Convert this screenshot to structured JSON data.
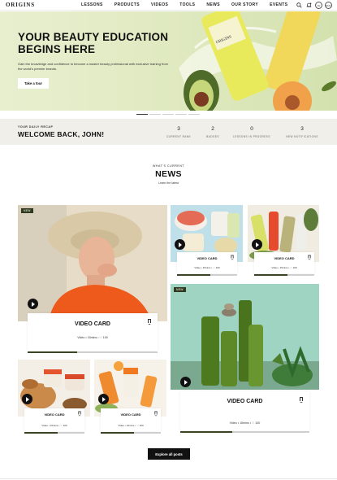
{
  "nav": {
    "logo": "ORIGINS",
    "menu": [
      "LESSONS",
      "PRODUCTS",
      "VIDEOS",
      "TOOLS",
      "NEWS",
      "OUR STORY",
      "EVENTS"
    ],
    "avatar_initials": "JH",
    "language": "ENG"
  },
  "hero": {
    "title": "YOUR BEAUTY EDUCATION BEGINS HERE",
    "subtitle": "Gain the knowledge and confidence to become a master beauty professional with exclusive training from the world's premier brands.",
    "cta": "Take a tour",
    "background": "#e2ebc6"
  },
  "recap": {
    "kicker": "YOUR DAILY RECAP",
    "welcome": "WELCOME BACK, JOHN!",
    "stats": [
      {
        "value": "3",
        "label": "CURRENT RANK"
      },
      {
        "value": "2",
        "label": "BADGES"
      },
      {
        "value": "0",
        "label": "LESSONS IN PROGRESS"
      },
      {
        "value": "3",
        "label": "NEW NOTIFICATIONS"
      }
    ]
  },
  "news": {
    "kicker": "WHAT'S CURRENT",
    "title": "NEWS",
    "subtitle": "Learn the latest"
  },
  "cards": [
    {
      "tag": "NEW",
      "title": "VIDEO CARD",
      "meta": "Video  •  15mins  •  ♡ 100",
      "progress": 0.38
    },
    {
      "tag": "",
      "title": "VIDEO CARD",
      "meta": "Video  •  15mins  •  ♡ 100",
      "progress": 0.55
    },
    {
      "tag": "",
      "title": "VIDEO CARD",
      "meta": "Video  •  15mins  •  ♡ 100",
      "progress": 0.55
    },
    {
      "tag": "NEW",
      "title": "VIDEO CARD",
      "meta": "Video  •  15mins  •  ♡ 100",
      "progress": 0.4
    },
    {
      "tag": "",
      "title": "VIDEO CARD",
      "meta": "Video  •  15mins  •  ♡ 100",
      "progress": 0.55
    },
    {
      "tag": "",
      "title": "VIDEO CARD",
      "meta": "Video  •  10mins  •  ♡ 100",
      "progress": 0.55
    }
  ],
  "explore_cta": "Explore all posts",
  "colors": {
    "accent": "#3b4424",
    "tag_bg": "#2f3a1e",
    "recap_bg": "#f1efea"
  }
}
